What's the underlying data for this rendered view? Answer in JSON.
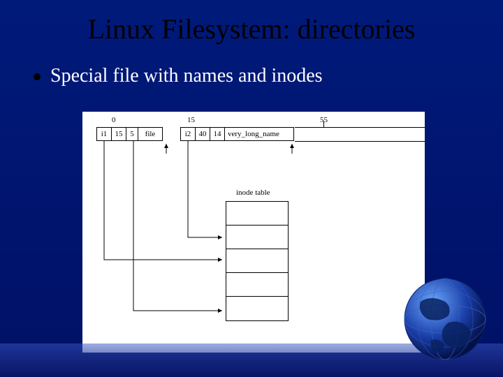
{
  "title": "Linux Filesystem: directories",
  "bullet": "Special file with names and inodes",
  "ruler": {
    "a": "0",
    "b": "15",
    "c": "55"
  },
  "entries": [
    {
      "inode": "i1",
      "reclen": "15",
      "namelen": "5",
      "name": "file"
    },
    {
      "inode": "i2",
      "reclen": "40",
      "namelen": "14",
      "name": "very_long_name"
    }
  ],
  "inode_table_label": "inode table",
  "chart_data": {
    "type": "diagram",
    "title": "Linux directory entry layout with inode table",
    "description": "A horizontal byte layout of two directory entries (each with inode#, record length, name length, filename). Arrows from each inode# field point down into rows of an inode table.",
    "byte_offsets_shown": [
      0,
      15,
      55
    ],
    "directory_entries": [
      {
        "inode": "i1",
        "record_length": 15,
        "name_length": 5,
        "name": "file"
      },
      {
        "inode": "i2",
        "record_length": 40,
        "name_length": 14,
        "name": "very_long_name"
      }
    ],
    "inode_table_rows_shown": 5
  }
}
